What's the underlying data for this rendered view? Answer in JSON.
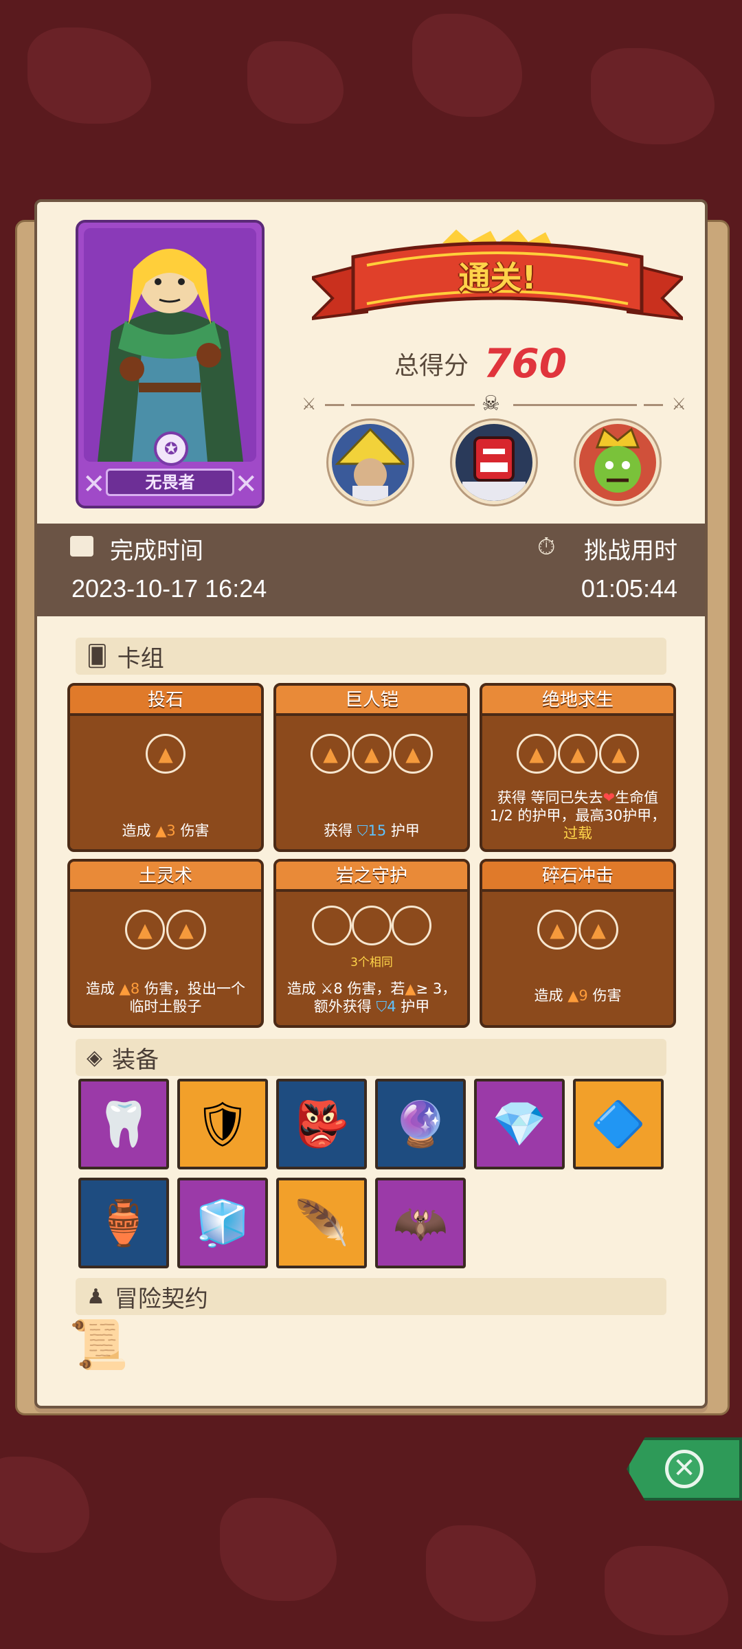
{
  "hero": {
    "name": "无畏者",
    "medal_icon": "star-medal-icon"
  },
  "result": {
    "banner": "通关!",
    "score_label": "总得分",
    "score_value": "760"
  },
  "bosses": [
    {
      "name": "straw-hat-boss-portrait"
    },
    {
      "name": "red-demon-boss-portrait"
    },
    {
      "name": "green-goblin-king-portrait"
    }
  ],
  "time": {
    "completed_label": "完成时间",
    "completed_value": "2023-10-17 16:24",
    "duration_label": "挑战用时",
    "duration_value": "01:05:44"
  },
  "deck": {
    "title": "卡组",
    "cards": [
      {
        "title": "投石",
        "desc_a": "造成 ",
        "num": "3",
        "desc_b": " 伤害"
      },
      {
        "title": "巨人铠",
        "desc_a": "获得 ",
        "num": "15",
        "desc_b": " 护甲"
      },
      {
        "title": "绝地求生",
        "line1": "获得 等同已失去",
        "line1b": "生命值",
        "line2": "1/2 的护甲，最高30护甲，",
        "line3": "过载"
      },
      {
        "title": "土灵术",
        "desc_a": "造成 ",
        "num": "8",
        "desc_b": " 伤害，投出一个",
        "line2": "临时土骰子"
      },
      {
        "title": "岩之守护",
        "sub": "3个相同",
        "line1": "造成 ",
        "num1": "8",
        "line1b": " 伤害，若",
        "line1c": "≥ 3，",
        "line2": "额外获得 ",
        "num2": "4",
        "line2b": " 护甲"
      },
      {
        "title": "碎石冲击",
        "desc_a": "造成 ",
        "num": "9",
        "desc_b": " 伤害"
      }
    ]
  },
  "equipment": {
    "title": "装备",
    "items": [
      {
        "icon": "twin-fangs-icon",
        "glyph": "🦷",
        "color": "purple"
      },
      {
        "icon": "bronze-ring-shield-icon",
        "glyph": "🛡",
        "color": "orange"
      },
      {
        "icon": "tiki-mask-icon",
        "glyph": "👺",
        "color": "blue"
      },
      {
        "icon": "amethyst-crystal-icon",
        "glyph": "🔮",
        "color": "blue"
      },
      {
        "icon": "ruby-gem-icon",
        "glyph": "💎",
        "color": "purple"
      },
      {
        "icon": "ice-amulet-icon",
        "glyph": "🔷",
        "color": "orange"
      },
      {
        "icon": "golden-seed-pot-icon",
        "glyph": "🏺",
        "color": "blue"
      },
      {
        "icon": "stone-cube-icon",
        "glyph": "🧊",
        "color": "purple"
      },
      {
        "icon": "phoenix-feather-icon",
        "glyph": "🪶",
        "color": "orange"
      },
      {
        "icon": "winged-crest-icon",
        "glyph": "🦇",
        "color": "purple"
      }
    ]
  },
  "contract": {
    "title": "冒险契约",
    "scroll_icon": "scroll-icon"
  },
  "close": {
    "icon": "close-icon",
    "glyph": "✕"
  }
}
